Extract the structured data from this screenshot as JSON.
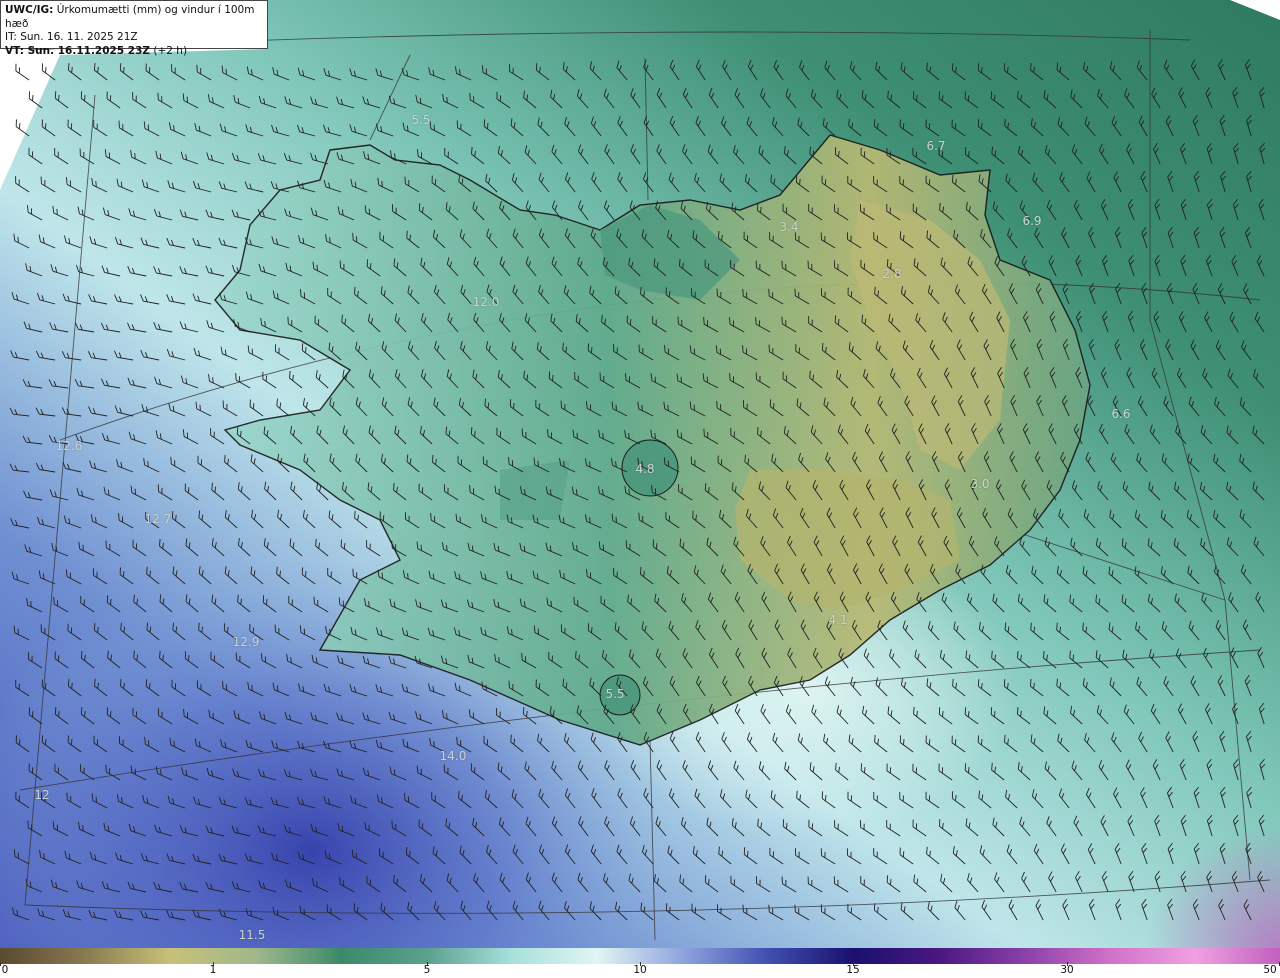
{
  "header": {
    "product": "UWC/IG:",
    "title": "Úrkomumætti (mm) og vindur í 100m hæð",
    "init_time": "IT: Sun. 16. 11. 2025 21Z",
    "valid_prefix": "VT: Sun. 16.11.2025 23Z",
    "valid_offset": "(+2 h)"
  },
  "colors": {
    "background_blank": "#ffffff",
    "coastline": "#1a1a1a",
    "grid": "#333333",
    "barb": "#222222",
    "label": "#c9d2d2"
  },
  "value_labels": [
    {
      "text": "5.5"
    },
    {
      "text": "6.7"
    },
    {
      "text": "3.4"
    },
    {
      "text": "6.9"
    },
    {
      "text": "2.8"
    },
    {
      "text": "12.0"
    },
    {
      "text": "6.6"
    },
    {
      "text": "12.6"
    },
    {
      "text": "4.8"
    },
    {
      "text": "3.0"
    },
    {
      "text": "12.7"
    },
    {
      "text": "4.1"
    },
    {
      "text": "12.9"
    },
    {
      "text": "5.5"
    },
    {
      "text": "14.0"
    },
    {
      "text": "12"
    },
    {
      "text": "11.5"
    }
  ],
  "colorbar": {
    "ticks": [
      "0",
      "1",
      "5",
      "10",
      "15",
      "30",
      "50"
    ],
    "stops": [
      "#5a4a30",
      "#8a7a50",
      "#c8c07a",
      "#9fb88a",
      "#3c8a6a",
      "#5aa08e",
      "#a8e0dc",
      "#dff5f3",
      "#8fa4de",
      "#4050b0",
      "#1a1070",
      "#4a1880",
      "#8a40a8",
      "#d070c8",
      "#f0a0e0",
      "#c060c0"
    ]
  },
  "icons": [
    "wind-barb-icon"
  ]
}
